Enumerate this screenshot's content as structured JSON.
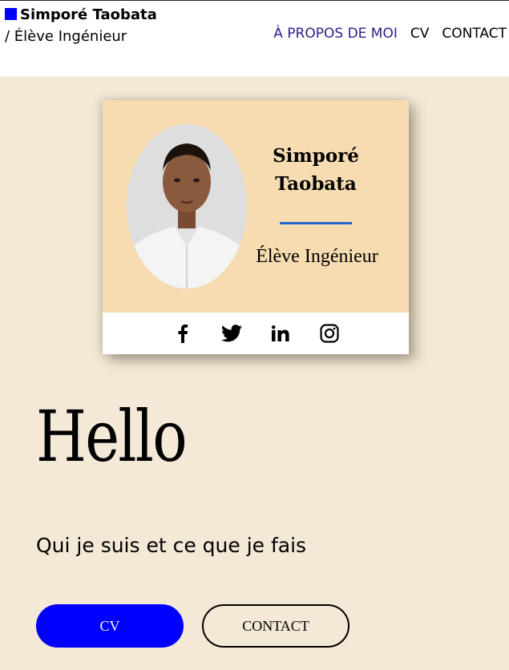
{
  "header": {
    "brand_name": "Simporé Taobata",
    "brand_separator": " / ",
    "brand_role": "Élève Ingénieur",
    "brand_color": "#0000ff",
    "nav": [
      {
        "label": "À PROPOS DE MOI",
        "active": true
      },
      {
        "label": "CV",
        "active": false
      },
      {
        "label": "CONTACT",
        "active": false
      }
    ]
  },
  "profile_card": {
    "name": "Simporé Taobata",
    "role": "Élève Ingénieur",
    "background": "#f6dcb0",
    "rule_color": "#2366c8",
    "social_icons": [
      "facebook-icon",
      "twitter-icon",
      "linkedin-icon",
      "instagram-icon"
    ]
  },
  "hero": {
    "title": "Hello",
    "subtitle": "Qui je suis et ce que je fais",
    "buttons": {
      "cv": "CV",
      "contact": "CONTACT"
    }
  }
}
